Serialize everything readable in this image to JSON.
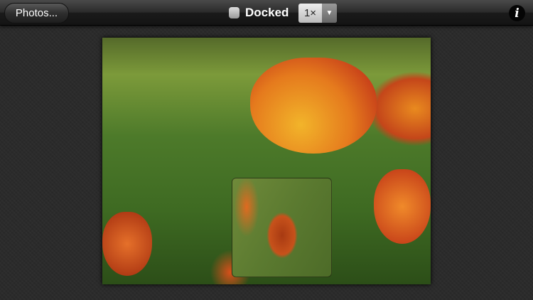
{
  "toolbar": {
    "photos_label": "Photos...",
    "docked_label": "Docked",
    "docked_checked": false,
    "zoom_value": "1×",
    "zoom_arrow": "▼",
    "info_label": "i"
  },
  "photo": {
    "description_icon": "photo-canvas"
  },
  "colors": {
    "toolbar": "#1a1a1a",
    "background": "#2b2b2b"
  }
}
